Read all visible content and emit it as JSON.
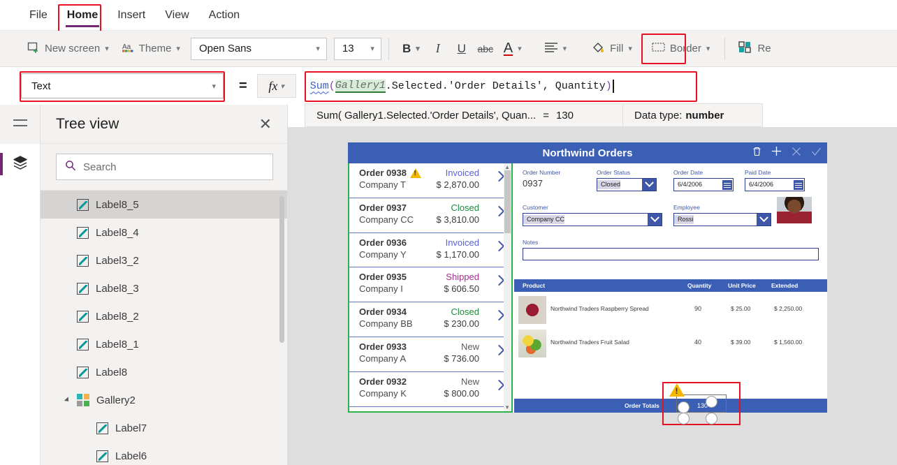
{
  "menu": {
    "items": [
      {
        "label": "File",
        "active": false
      },
      {
        "label": "Home",
        "active": true
      },
      {
        "label": "Insert",
        "active": false
      },
      {
        "label": "View",
        "active": false
      },
      {
        "label": "Action",
        "active": false
      }
    ]
  },
  "toolbar": {
    "new_screen": "New screen",
    "theme": "Theme",
    "font_family": "Open Sans",
    "font_size": "13",
    "bold": "B",
    "italic": "I",
    "underline": "U",
    "strikethrough": "abc",
    "font_color": "A",
    "align": "align-icon",
    "fill": "Fill",
    "border": "Border",
    "reorder": "Re"
  },
  "formula": {
    "property": "Text",
    "equals": "=",
    "fx": "fx",
    "tokens": [
      {
        "text": "Sum",
        "type": "fn"
      },
      {
        "text": "(",
        "type": "paren"
      },
      {
        "text": " ",
        "type": "plain"
      },
      {
        "text": "Gallery1",
        "type": "ctrl"
      },
      {
        "text": ".Selected.'Order Details', Quantity ",
        "type": "plain"
      },
      {
        "text": ")",
        "type": "paren"
      }
    ],
    "full_text": "Sum( Gallery1.Selected.'Order Details', Quantity )"
  },
  "result": {
    "expression": "Sum( Gallery1.Selected.'Order Details', Quan...",
    "equals": "=",
    "value": "130",
    "datatype_label": "Data type:",
    "datatype_value": "number"
  },
  "tree": {
    "title": "Tree view",
    "close": "✕",
    "search_placeholder": "Search",
    "items": [
      {
        "label": "Label8_5",
        "icon": "label-icon",
        "selected": true,
        "indent": 0
      },
      {
        "label": "Label8_4",
        "icon": "label-icon",
        "selected": false,
        "indent": 0
      },
      {
        "label": "Label3_2",
        "icon": "label-icon",
        "selected": false,
        "indent": 0
      },
      {
        "label": "Label8_3",
        "icon": "label-icon",
        "selected": false,
        "indent": 0
      },
      {
        "label": "Label8_2",
        "icon": "label-icon",
        "selected": false,
        "indent": 0
      },
      {
        "label": "Label8_1",
        "icon": "label-icon",
        "selected": false,
        "indent": 0
      },
      {
        "label": "Label8",
        "icon": "label-icon",
        "selected": false,
        "indent": 0
      },
      {
        "label": "Gallery2",
        "icon": "gallery-icon",
        "selected": false,
        "indent": 0,
        "expanded": true
      },
      {
        "label": "Label7",
        "icon": "label-icon",
        "selected": false,
        "indent": 1
      },
      {
        "label": "Label6",
        "icon": "label-icon",
        "selected": false,
        "indent": 1
      }
    ]
  },
  "app": {
    "title": "Northwind Orders",
    "header_icons": [
      "trash-icon",
      "add-icon",
      "cancel-icon",
      "check-icon"
    ],
    "gallery": {
      "rows": [
        {
          "order": "Order 0938",
          "company": "Company T",
          "status": "Invoiced",
          "status_color": "#5b63d3",
          "amount": "$ 2,870.00",
          "warning": true
        },
        {
          "order": "Order 0937",
          "company": "Company CC",
          "status": "Closed",
          "status_color": "#1f8a3b",
          "amount": "$ 3,810.00",
          "warning": false
        },
        {
          "order": "Order 0936",
          "company": "Company Y",
          "status": "Invoiced",
          "status_color": "#5b63d3",
          "amount": "$ 1,170.00",
          "warning": false
        },
        {
          "order": "Order 0935",
          "company": "Company I",
          "status": "Shipped",
          "status_color": "#a4308f",
          "amount": "$ 606.50",
          "warning": false
        },
        {
          "order": "Order 0934",
          "company": "Company BB",
          "status": "Closed",
          "status_color": "#1f8a3b",
          "amount": "$ 230.00",
          "warning": false
        },
        {
          "order": "Order 0933",
          "company": "Company A",
          "status": "New",
          "status_color": "#5a5a5a",
          "amount": "$ 736.00",
          "warning": false
        },
        {
          "order": "Order 0932",
          "company": "Company K",
          "status": "New",
          "status_color": "#5a5a5a",
          "amount": "$ 800.00",
          "warning": false
        }
      ]
    },
    "form": {
      "order_number_label": "Order Number",
      "order_number_value": "0937",
      "order_status_label": "Order Status",
      "order_status_value": "Closed",
      "order_date_label": "Order Date",
      "order_date_value": "6/4/2006",
      "paid_date_label": "Paid Date",
      "paid_date_value": "6/4/2006",
      "customer_label": "Customer",
      "customer_value": "Company CC",
      "employee_label": "Employee",
      "employee_value": "Rossi",
      "notes_label": "Notes",
      "notes_value": ""
    },
    "products": {
      "columns": [
        "Product",
        "Quantity",
        "Unit Price",
        "Extended"
      ],
      "rows": [
        {
          "name": "Northwind Traders Raspberry Spread",
          "qty": "90",
          "price": "$ 25.00",
          "ext": "$ 2,250.00"
        },
        {
          "name": "Northwind Traders Fruit Salad",
          "qty": "40",
          "price": "$ 39.00",
          "ext": "$ 1,560.00"
        }
      ],
      "totals_label": "Order Totals",
      "totals_value": "130"
    }
  },
  "colors": {
    "accent_purple": "#742774",
    "app_blue": "#3b5fb5",
    "highlight_red": "#e81123",
    "selection_green": "#2eb24c",
    "warning_yellow": "#f5b800"
  }
}
